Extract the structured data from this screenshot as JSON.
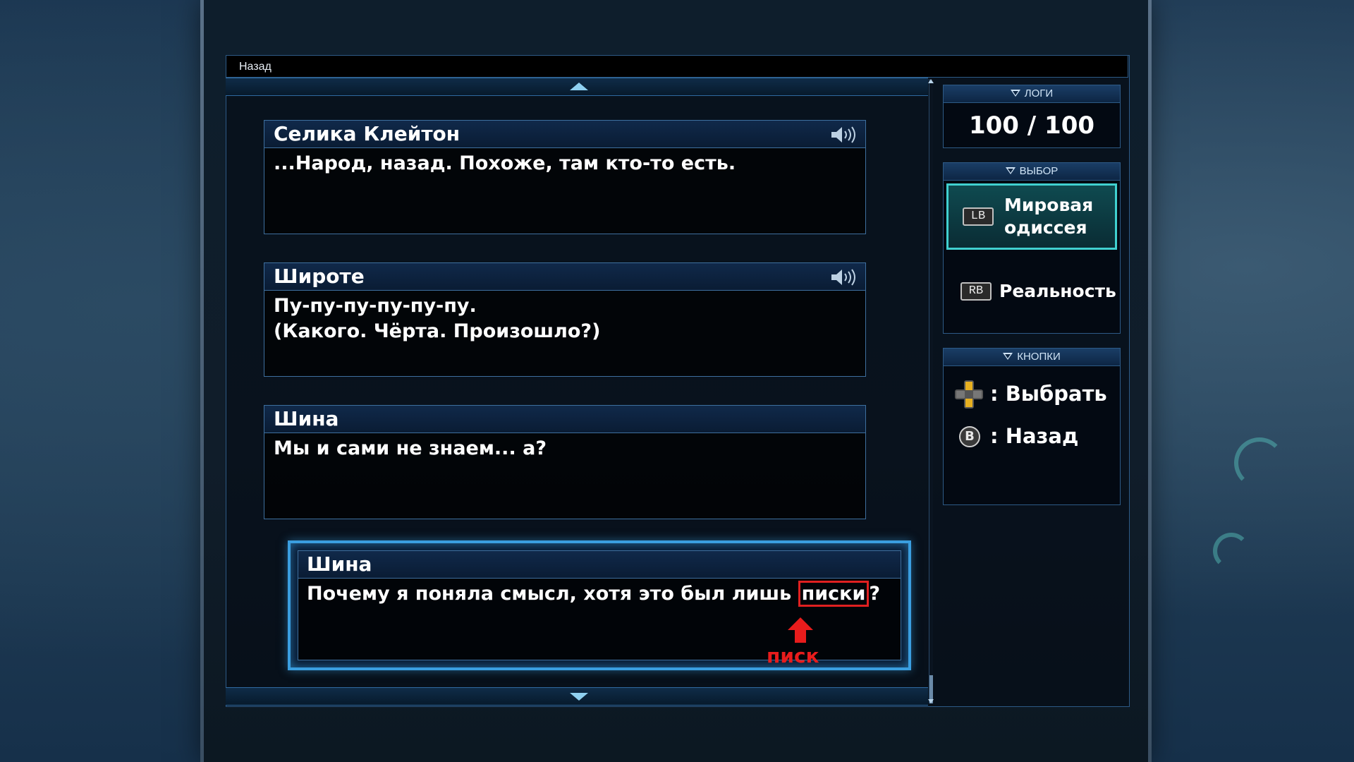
{
  "header": {
    "back_label": "Назад"
  },
  "log_entries": [
    {
      "speaker": "Селика Клейтон",
      "text": "...Народ, назад. Похоже, там кто-то есть.",
      "has_voice": true
    },
    {
      "speaker": "Широте",
      "text": "Пу-пу-пу-пу-пу-пу.\n(Какого. Чёрта. Произошло?)",
      "has_voice": true
    },
    {
      "speaker": "Шина",
      "text": "Мы и сами не знаем... а?",
      "has_voice": false
    }
  ],
  "selected_entry": {
    "speaker": "Шина",
    "text_before": "Почему я поняла смысл, хотя это был лишь ",
    "highlighted_word": "писки",
    "text_after": "?",
    "annotation": "писк"
  },
  "sidebar": {
    "logs": {
      "title": "ЛОГИ",
      "value": "100 / 100"
    },
    "choice": {
      "title": "ВЫБОР",
      "options": [
        {
          "button": "LB",
          "label": "Мировая\nодиссея",
          "active": true
        },
        {
          "button": "RB",
          "label": "Реальность",
          "active": false
        }
      ]
    },
    "buttons": {
      "title": "КНОПКИ",
      "items": [
        {
          "icon": "dpad-icon",
          "label": ": Выбрать"
        },
        {
          "icon": "b-button-icon",
          "button": "B",
          "label": ": Назад"
        }
      ]
    }
  },
  "colors": {
    "accent": "#3a9ee0",
    "active_choice": "#40d0d0",
    "highlight": "#e02020"
  }
}
